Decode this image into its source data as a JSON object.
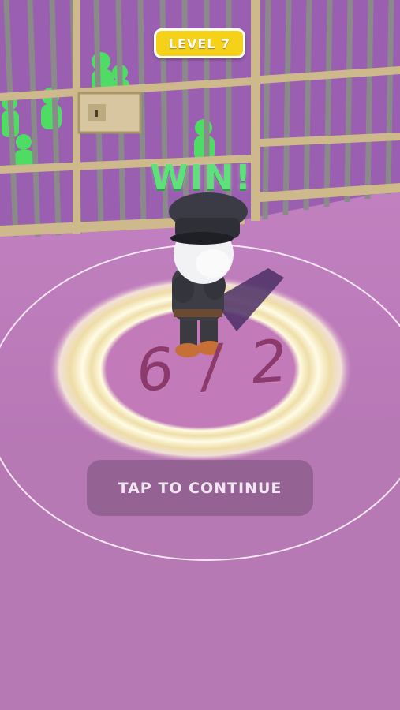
{
  "hud": {
    "level_label": "LEVEL 7"
  },
  "result": {
    "win_label": "WIN!",
    "counter": "6 / 2"
  },
  "actions": {
    "continue_label": "TAP TO CONTINUE"
  },
  "colors": {
    "floor": "#b57ab3",
    "arena_floor": "#c47fc4",
    "badge": "#f6d11a",
    "win_text": "#5ee07a",
    "counter_text": "#8c3a6c",
    "prisoner": "#4fdc64",
    "cage_bars": "#8c8c8c",
    "cage_frame": "#c9b48a"
  },
  "icons": {
    "player": "police-officer-character",
    "prisoners": "green-prisoner-figures",
    "cage": "jail-cage",
    "glow_rings": "glowing-target-rings"
  }
}
